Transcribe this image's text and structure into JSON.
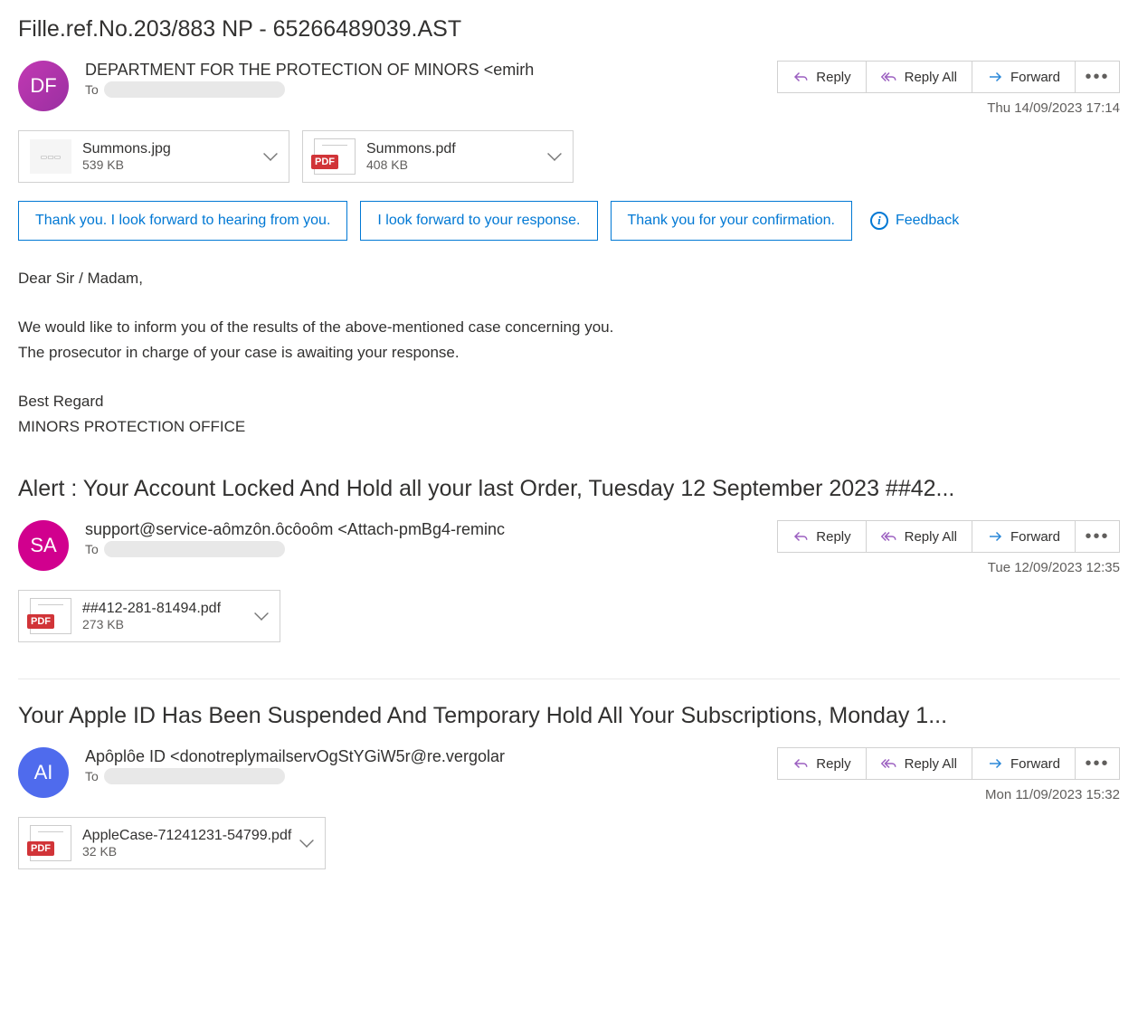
{
  "labels": {
    "to": "To",
    "reply": "Reply",
    "reply_all": "Reply All",
    "forward": "Forward",
    "feedback": "Feedback"
  },
  "suggestions": [
    "Thank you. I look forward to hearing from you.",
    "I look forward to your response.",
    "Thank you for your confirmation."
  ],
  "emails": [
    {
      "subject": "Fille.ref.No.203/883 NP - 65266489039.AST",
      "avatar": "DF",
      "from": "DEPARTMENT FOR THE PROTECTION OF MINORS <emirh",
      "timestamp": "Thu 14/09/2023 17:14",
      "attachments": [
        {
          "name": "Summons.jpg",
          "size": "539 KB",
          "type": "image"
        },
        {
          "name": "Summons.pdf",
          "size": "408 KB",
          "type": "pdf"
        }
      ],
      "body": {
        "l1": "Dear Sir / Madam,",
        "l2": "We would like to inform you of the results of the above-mentioned case concerning you.",
        "l3": "The prosecutor in charge of your case is awaiting your response.",
        "l4": "Best Regard",
        "l5": "MINORS PROTECTION OFFICE"
      }
    },
    {
      "subject": "Alert : Your Account Locked And Hold all your last Order, Tuesday 12 September 2023 ##42...",
      "avatar": "SA",
      "from": "support@service-aȏmzȏn.ȏcȏoȏm <Attach-pmBg4-reminc",
      "timestamp": "Tue 12/09/2023 12:35",
      "attachments": [
        {
          "name": "##412-281-81494.pdf",
          "size": "273 KB",
          "type": "pdf"
        }
      ]
    },
    {
      "subject": "Your Apple ID Has Been Suspended And Temporary Hold All Your Subscriptions, Monday 1...",
      "avatar": "AI",
      "from": "Apȏplȏe ID <donotreplymailservOgStYGiW5r@re.vergolar",
      "timestamp": "Mon 11/09/2023 15:32",
      "attachments": [
        {
          "name": "AppleCase-71241231-54799.pdf",
          "size": "32 KB",
          "type": "pdf"
        }
      ]
    }
  ]
}
